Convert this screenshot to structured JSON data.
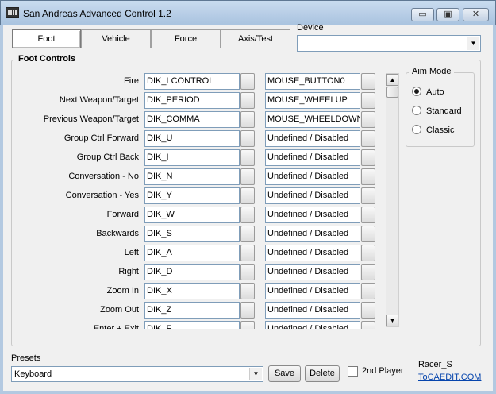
{
  "window": {
    "title": "San Andreas Advanced Control 1.2",
    "minimize_glyph": "▭",
    "maximize_glyph": "▣",
    "close_glyph": "✕"
  },
  "tabs": [
    "Foot",
    "Vehicle",
    "Force",
    "Axis/Test"
  ],
  "active_tab": "Foot",
  "device": {
    "label": "Device",
    "value": ""
  },
  "foot_controls": {
    "title": "Foot Controls",
    "rows": [
      {
        "label": "Fire",
        "key": "DIK_LCONTROL",
        "mouse": "MOUSE_BUTTON0"
      },
      {
        "label": "Next Weapon/Target",
        "key": "DIK_PERIOD",
        "mouse": "MOUSE_WHEELUP"
      },
      {
        "label": "Previous Weapon/Target",
        "key": "DIK_COMMA",
        "mouse": "MOUSE_WHEELDOWN"
      },
      {
        "label": "Group Ctrl Forward",
        "key": "DIK_U",
        "mouse": "Undefined / Disabled"
      },
      {
        "label": "Group Ctrl Back",
        "key": "DIK_I",
        "mouse": "Undefined / Disabled"
      },
      {
        "label": "Conversation - No",
        "key": "DIK_N",
        "mouse": "Undefined / Disabled"
      },
      {
        "label": "Conversation - Yes",
        "key": "DIK_Y",
        "mouse": "Undefined / Disabled"
      },
      {
        "label": "Forward",
        "key": "DIK_W",
        "mouse": "Undefined / Disabled"
      },
      {
        "label": "Backwards",
        "key": "DIK_S",
        "mouse": "Undefined / Disabled"
      },
      {
        "label": "Left",
        "key": "DIK_A",
        "mouse": "Undefined / Disabled"
      },
      {
        "label": "Right",
        "key": "DIK_D",
        "mouse": "Undefined / Disabled"
      },
      {
        "label": "Zoom In",
        "key": "DIK_X",
        "mouse": "Undefined / Disabled"
      },
      {
        "label": "Zoom Out",
        "key": "DIK_Z",
        "mouse": "Undefined / Disabled"
      },
      {
        "label": "Enter + Exit",
        "key": "DIK_F",
        "mouse": "Undefined / Disabled"
      }
    ]
  },
  "scroll": {
    "up_glyph": "▲",
    "down_glyph": "▼"
  },
  "aim_mode": {
    "title": "Aim Mode",
    "options": [
      "Auto",
      "Standard",
      "Classic"
    ],
    "selected": "Auto"
  },
  "presets": {
    "label": "Presets",
    "value": "Keyboard",
    "arrow": "▼"
  },
  "buttons": {
    "save": "Save",
    "delete": "Delete"
  },
  "second_player": {
    "label": "2nd Player",
    "checked": false
  },
  "credits": {
    "author": "Racer_S",
    "link": "ToCAEDIT.COM"
  }
}
